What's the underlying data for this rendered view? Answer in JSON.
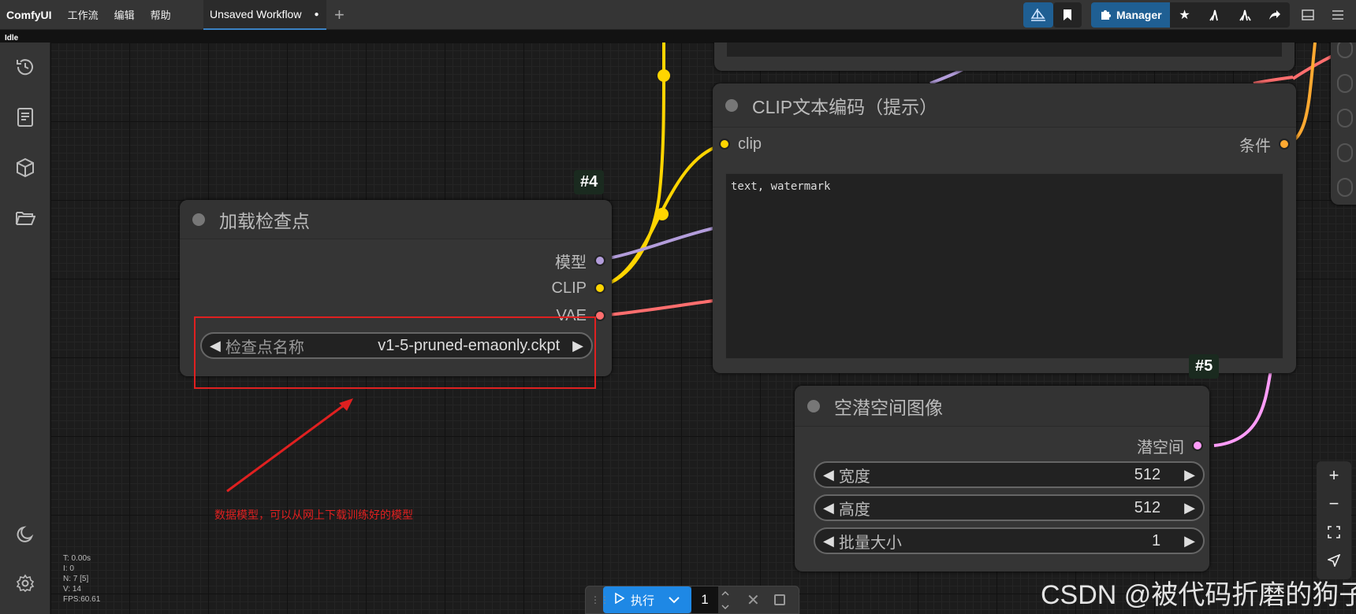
{
  "app": {
    "brand": "ComfyUI",
    "menus": [
      "工作流",
      "编辑",
      "帮助"
    ],
    "tab_title": "Unsaved Workflow",
    "tab_dot": "●",
    "manager_label": "Manager",
    "status": "Idle"
  },
  "nodes": {
    "checkpoint": {
      "badge": "#4",
      "title": "加载检查点",
      "outputs": [
        "模型",
        "CLIP",
        "VAE"
      ],
      "widget_label": "检查点名称",
      "widget_value": "v1-5-pruned-emaonly.ckpt"
    },
    "clip_text": {
      "badge": "#5",
      "title": "CLIP文本编码（提示）",
      "input": "clip",
      "output": "条件",
      "text": "text, watermark"
    },
    "latent": {
      "title": "空潜空间图像",
      "output": "潜空间",
      "widgets": [
        {
          "label": "宽度",
          "value": "512"
        },
        {
          "label": "高度",
          "value": "512"
        },
        {
          "label": "批量大小",
          "value": "1"
        }
      ]
    }
  },
  "annotation": {
    "text": "数据模型，可以从网上下载训练好的模型"
  },
  "stats": [
    "T: 0.00s",
    "I: 0",
    "N: 7 [5]",
    "V: 14",
    "FPS:60.61"
  ],
  "run": {
    "label": "执行",
    "count": "1"
  },
  "watermark": "CSDN @被代码折磨的狗子",
  "colors": {
    "model_link": "#b39ddb",
    "clip_link": "#ffd500",
    "vae_link": "#ff6e6e",
    "latent_link": "#ff9cf9",
    "conditioning_link": "#ffa931",
    "accent": "#1f5f93"
  }
}
